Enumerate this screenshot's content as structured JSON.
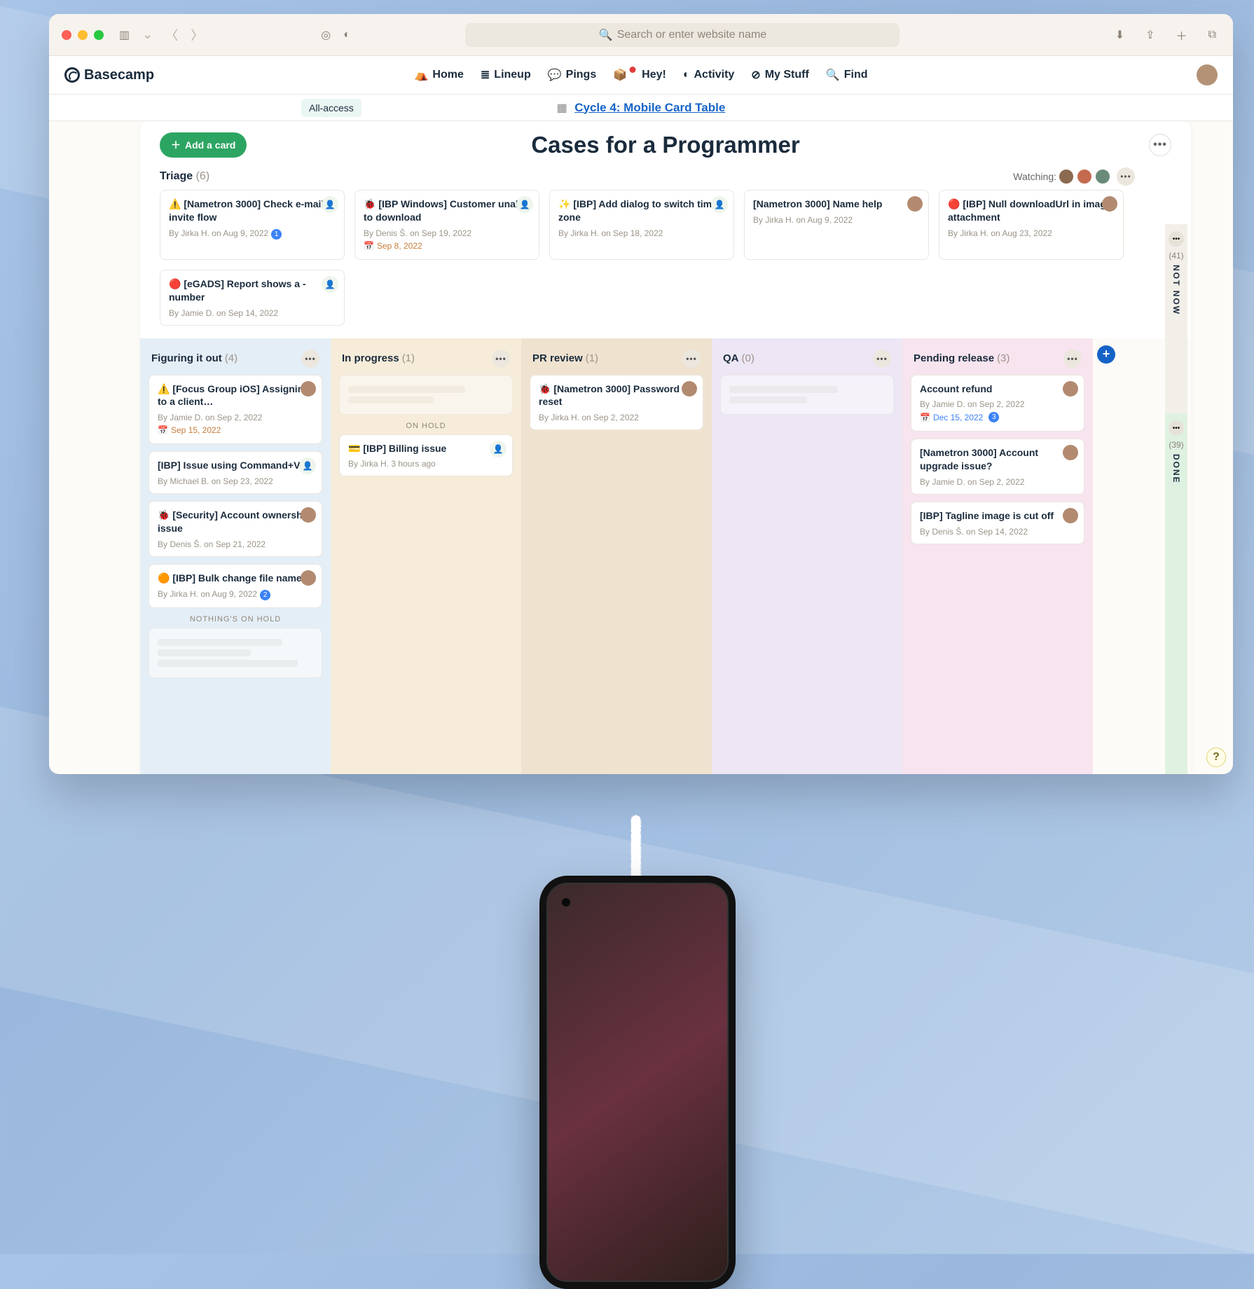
{
  "browser": {
    "search_placeholder": "Search or enter website name"
  },
  "app": {
    "brand": "Basecamp",
    "nav": [
      "Home",
      "Lineup",
      "Pings",
      "Hey!",
      "Activity",
      "My Stuff",
      "Find"
    ],
    "nav_icons": [
      "⛺",
      "≣",
      "💬",
      "📦",
      "◐",
      "⊘",
      "🔍"
    ]
  },
  "submenu": {
    "all_access": "All-access",
    "cycle_link": "Cycle 4: Mobile Card Table"
  },
  "page": {
    "add_card": "Add a card",
    "title": "Cases for a Programmer",
    "watching_label": "Watching:",
    "triage": {
      "label": "Triage",
      "count": "(6)"
    },
    "nothings_on_hold": "NOTHING'S ON HOLD",
    "on_hold": "ON HOLD"
  },
  "triage_cards": [
    {
      "title": "⚠️ [Nametron 3000] Check e-mail invite flow",
      "meta": "By Jirka H. on Aug 9, 2022",
      "badge": "1",
      "icon": true
    },
    {
      "title": "🐞 [IBP Windows] Customer unable to download",
      "meta": "By Denis Š. on Sep 19, 2022",
      "date": "Sep 8, 2022",
      "icon": true
    },
    {
      "title": "✨ [IBP] Add dialog to switch time zone",
      "meta": "By Jirka H. on Sep 18, 2022",
      "icon": true
    },
    {
      "title": "[Nametron 3000] Name help",
      "meta": "By Jirka H. on Aug 9, 2022",
      "avatar": true
    },
    {
      "title": "🔴 [IBP] Null downloadUrl in image attachment",
      "meta": "By Jirka H. on Aug 23, 2022",
      "avatar": true
    },
    {
      "title": "🔴 [eGADS] Report shows a -number",
      "meta": "By Jamie D. on Sep 14, 2022",
      "icon": true
    }
  ],
  "columns": {
    "figuring": {
      "title": "Figuring it out",
      "count": "(4)",
      "cards": [
        {
          "title": "⚠️ [Focus Group iOS] Assigning to a client…",
          "meta": "By Jamie D. on Sep 2, 2022",
          "date": "Sep 15, 2022",
          "avatar": true
        },
        {
          "title": "[IBP] Issue using Command+V",
          "meta": "By Michael B. on Sep 23, 2022",
          "icon": true
        },
        {
          "title": "🐞 [Security] Account ownership issue",
          "meta": "By Denis Š. on Sep 21, 2022",
          "avatar": true
        },
        {
          "title": "🟠 [IBP] Bulk change file names",
          "meta": "By Jirka H. on Aug 9, 2022",
          "badge": "2",
          "avatar": true
        }
      ]
    },
    "inprog": {
      "title": "In progress",
      "count": "(1)",
      "hold_card": {
        "title": "💳 [IBP] Billing issue",
        "meta": "By Jirka H. 3 hours ago"
      }
    },
    "pr": {
      "title": "PR review",
      "count": "(1)",
      "cards": [
        {
          "title": "🐞 [Nametron 3000] Password reset",
          "meta": "By Jirka H. on Sep 2, 2022",
          "avatar": true
        }
      ]
    },
    "qa": {
      "title": "QA",
      "count": "(0)"
    },
    "pending": {
      "title": "Pending release",
      "count": "(3)",
      "cards": [
        {
          "title": "Account refund",
          "meta": "By Jamie D. on Sep 2, 2022",
          "date": "Dec 15, 2022",
          "badge": "3",
          "avatar": true
        },
        {
          "title": "[Nametron 3000] Account upgrade issue?",
          "meta": "By Jamie D. on Sep 2, 2022",
          "avatar": true
        },
        {
          "title": "[IBP] Tagline image is cut off",
          "meta": "By Denis Š. on Sep 14, 2022",
          "avatar": true
        }
      ]
    }
  },
  "strips": {
    "notnow": {
      "count": "(41)",
      "label": "NOT NOW"
    },
    "done": {
      "count": "(39)",
      "label": "DONE"
    }
  }
}
